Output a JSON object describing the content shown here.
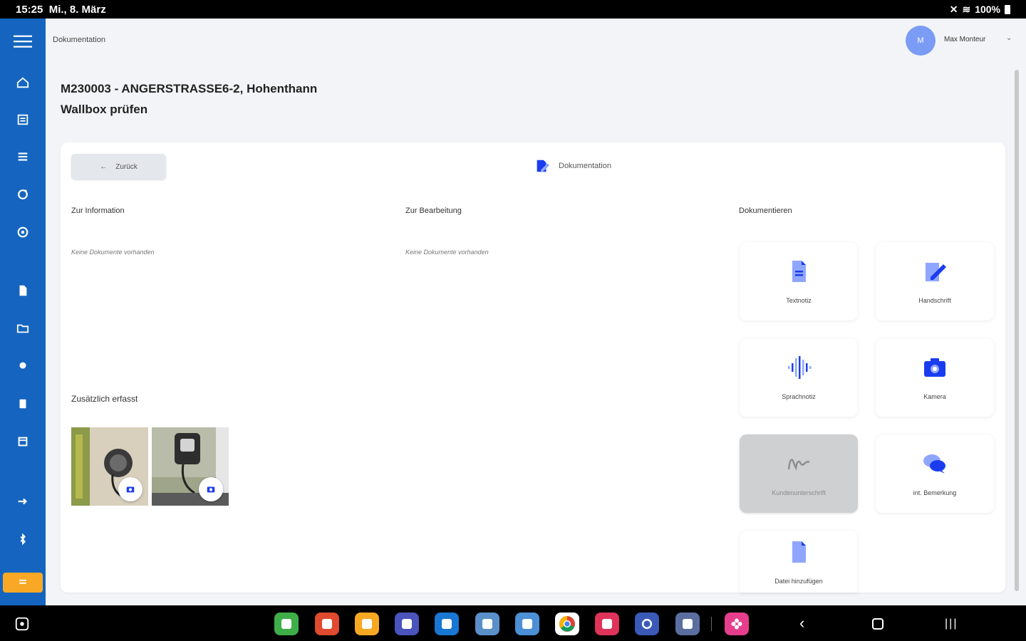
{
  "status": {
    "time": "15:25",
    "date": "Mi., 8. März",
    "battery": "100%"
  },
  "header": {
    "breadcrumb": "Dokumentation",
    "avatar_initial": "M",
    "user_name": "Max Monteur"
  },
  "job": {
    "title": "M230003 - ANGERSTRASSE6-2, Hohenthann",
    "subtitle": "Wallbox prüfen"
  },
  "card": {
    "back_label": "Zurück",
    "doc_title": "Dokumentation",
    "columns": {
      "info": "Zur Information",
      "edit": "Zur Bearbeitung",
      "capture": "Dokumentieren"
    },
    "empty_info": "Keine Dokumente vorhanden",
    "empty_edit": "Keine Dokumente vorhanden",
    "additional": "Zusätzlich erfasst"
  },
  "tiles": {
    "text": "Textnotiz",
    "handwriting": "Handschrift",
    "voice": "Sprachnotiz",
    "camera": "Kamera",
    "signature": "Kundenunterschrift",
    "remark": "int. Bemerkung",
    "file": "Datei hinzufügen"
  },
  "colors": {
    "sidebar": "#1565c0",
    "accent": "#f9a825",
    "icon_blue": "#1a3cf0",
    "icon_light": "#8fa6ff"
  }
}
